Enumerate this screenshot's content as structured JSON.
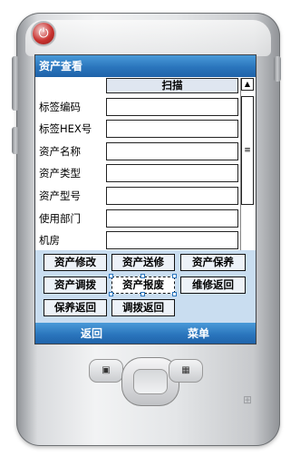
{
  "window": {
    "title": "资产查看"
  },
  "form": {
    "scan_label": "扫描",
    "fields": [
      {
        "label": "标签编码",
        "value": ""
      },
      {
        "label": "标签HEX号",
        "value": ""
      },
      {
        "label": "资产名称",
        "value": ""
      },
      {
        "label": "资产类型",
        "value": ""
      },
      {
        "label": "资产型号",
        "value": ""
      },
      {
        "label": "使用部门",
        "value": ""
      },
      {
        "label": "机房",
        "value": ""
      }
    ]
  },
  "scrollbar": {
    "up_glyph": "▲",
    "thumb_glyph": "≡"
  },
  "actions": {
    "modify": "资产修改",
    "send_repair": "资产送修",
    "maintain": "资产保养",
    "transfer": "资产调拨",
    "scrap": "资产报废",
    "repair_return": "维修返回",
    "maintain_return": "保养返回",
    "transfer_return": "调拨返回"
  },
  "menubar": {
    "back": "返回",
    "menu": "菜单"
  },
  "device": {
    "power_glyph": "⏻",
    "left_key_glyph": "▣",
    "right_key_glyph": "▦",
    "logo_glyph": "⊞"
  },
  "colors": {
    "accent": "#2a75bd",
    "panel": "#c9ddf0",
    "power": "#c9322f"
  }
}
